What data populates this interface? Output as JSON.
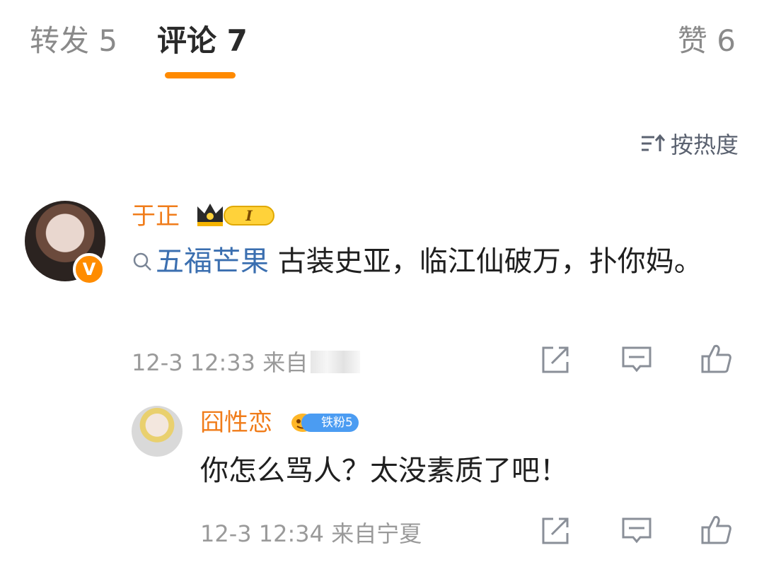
{
  "tabs": {
    "forward_label": "转发 5",
    "comment_label": "评论 7",
    "like_label": "赞 6"
  },
  "sort": {
    "label": "按热度"
  },
  "comments": [
    {
      "username": "于正",
      "level_badge": "I",
      "topic": "五福芒果",
      "text": " 古装史亚，临江仙破万，扑你妈。",
      "timestamp": "12-3 12:33",
      "source_prefix": "来自"
    },
    {
      "username": "囧性恋",
      "fan_badge": "铁粉5",
      "text": "你怎么骂人？太没素质了吧！",
      "timestamp": "12-3 12:34",
      "source": "来自宁夏"
    }
  ],
  "colors": {
    "accent": "#ff8a00",
    "username": "#f07c1a",
    "topic": "#3b6fb0",
    "meta": "#9a9a9a"
  },
  "icons": {
    "sort": "sort-icon",
    "topic": "search-icon",
    "share": "share-icon",
    "comment": "comment-icon",
    "like": "thumbs-up-icon",
    "verified": "verified-v-icon"
  }
}
